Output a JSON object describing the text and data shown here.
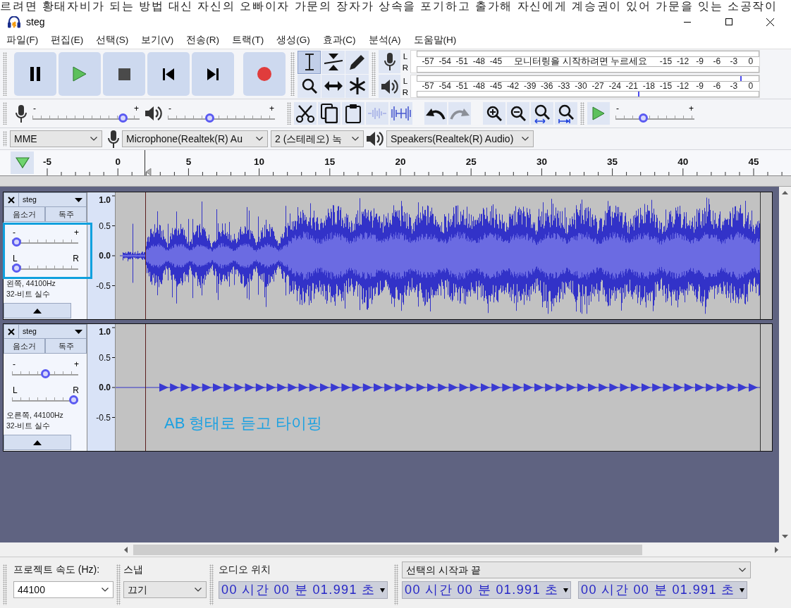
{
  "background_text": "르려면 황태자비가 되는 방법 대신 자신의 오빠이자 가문의 장자가 상속을 포기하고 출가해 자신에게 계승권이 있어 가문을 잇는 소공작이",
  "window": {
    "title": "steg"
  },
  "menu": [
    "파일(F)",
    "편집(E)",
    "선택(S)",
    "보기(V)",
    "전송(R)",
    "트랙(T)",
    "생성(G)",
    "효과(C)",
    "분석(A)",
    "도움말(H)"
  ],
  "transport": [
    {
      "kind": "pause"
    },
    {
      "kind": "play"
    },
    {
      "kind": "stop"
    },
    {
      "kind": "skip_start"
    },
    {
      "kind": "skip_end"
    },
    {
      "kind": "record"
    }
  ],
  "tools": [
    {
      "kind": "select",
      "selected": true
    },
    {
      "kind": "envelope",
      "selected": false
    },
    {
      "kind": "draw",
      "selected": false
    },
    {
      "kind": "zoom",
      "selected": false
    },
    {
      "kind": "time_shift",
      "selected": false
    },
    {
      "kind": "multi",
      "selected": false
    }
  ],
  "record_meter": {
    "channels": [
      {
        "label": "L"
      },
      {
        "label": "R"
      }
    ],
    "scale_start": [
      "-57",
      "-54",
      "-51",
      "-48",
      "-45"
    ],
    "message": "모니터링을 시작하려면 누르세요",
    "scale_end": [
      "-15",
      "-12",
      "-9",
      "-6",
      "-3",
      "0"
    ]
  },
  "play_meter": {
    "channels": [
      {
        "label": "L",
        "level": 0.95
      },
      {
        "label": "R",
        "level": 0.65
      }
    ],
    "scale": [
      "-57",
      "-54",
      "-51",
      "-48",
      "-45",
      "-42",
      "-39",
      "-36",
      "-33",
      "-30",
      "-27",
      "-24",
      "-21",
      "-18",
      "-15",
      "-12",
      "-9",
      "-6",
      "-3",
      "0"
    ]
  },
  "mixer": {
    "record_volume": {
      "minus": "-",
      "plus": "+",
      "level": 0.88
    },
    "play_volume": {
      "minus": "-",
      "plus": "+",
      "level": 0.38
    }
  },
  "edit_tools": [
    [
      {
        "kind": "cut",
        "disabled": false
      },
      {
        "kind": "copy",
        "disabled": false
      },
      {
        "kind": "paste",
        "disabled": false
      },
      {
        "kind": "trim",
        "disabled": true
      },
      {
        "kind": "silence",
        "disabled": false
      }
    ],
    [
      {
        "kind": "undo",
        "disabled": false
      },
      {
        "kind": "redo",
        "disabled": true
      }
    ],
    [
      {
        "kind": "zoom_in",
        "disabled": false
      },
      {
        "kind": "zoom_out",
        "disabled": false
      },
      {
        "kind": "fit_selection",
        "disabled": false
      },
      {
        "kind": "fit_project",
        "disabled": false
      }
    ]
  ],
  "play_at_speed": {
    "minus": "-",
    "plus": "+",
    "level": 0.33
  },
  "devices": {
    "host": "MME",
    "input": "Microphone(Realtek(R) Au",
    "channels": "2 (스테레오) 녹",
    "output": "Speakers(Realtek(R) Audio)"
  },
  "timeline": {
    "labels": [
      "-5",
      "0",
      "5",
      "10",
      "15",
      "20",
      "25",
      "30",
      "35",
      "40",
      "45"
    ]
  },
  "tracks": [
    {
      "kind": "speech",
      "name": "steg",
      "mute": "음소거",
      "solo": "독주",
      "gain": {
        "minus": "-",
        "plus": "+",
        "level": 0
      },
      "pan": {
        "left": "L",
        "right": "R",
        "level": 0
      },
      "info": [
        "왼쪽, 44100Hz",
        "32-비트 실수"
      ],
      "scale": [
        "1.0",
        "0.5",
        "0.0",
        "-0.5"
      ]
    },
    {
      "kind": "tone",
      "name": "steg",
      "mute": "음소거",
      "solo": "독주",
      "gain": {
        "minus": "-",
        "plus": "+",
        "level": 0.5
      },
      "pan": {
        "left": "L",
        "right": "R",
        "level": 1
      },
      "info": [
        "오른쪽, 44100Hz",
        "32-비트 실수"
      ],
      "scale": [
        "1.0",
        "0.5",
        "0.0",
        "-0.5"
      ]
    }
  ],
  "annotation": {
    "text": "AB 형태로 듣고 타이핑"
  },
  "selection_bar": {
    "rate_label": "프로젝트 속도 (Hz):",
    "rate": "44100",
    "snap_label": "스냅",
    "snap": "끄기",
    "position_label": "오디오 위치",
    "position": "00 시간 00 분 01.991 초",
    "selection_mode": "선택의 시작과 끝",
    "selection_start": "00 시간 00 분 01.991 초",
    "selection_end": "00 시간 00 분 01.991 초"
  }
}
